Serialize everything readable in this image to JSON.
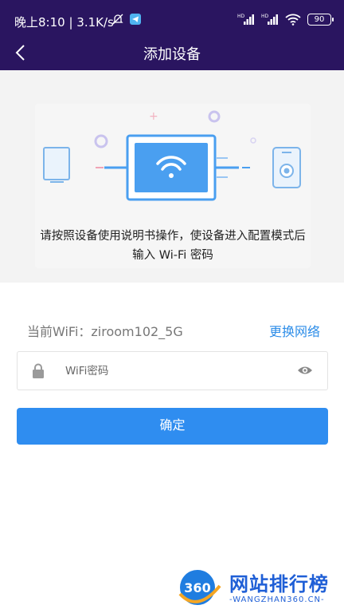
{
  "status_bar": {
    "time": "晚上8:10 | 3.1K/s",
    "battery": "90",
    "signal_labels": [
      "HD",
      "HD"
    ]
  },
  "header": {
    "title": "添加设备"
  },
  "hero": {
    "instruction": "请按照设备使用说明书操作，使设备进入配置模式后输入 Wi-Fi 密码"
  },
  "wifi": {
    "current_label": "当前WiFi：ziroom102_5G",
    "change_network": "更换网络"
  },
  "password": {
    "placeholder": "WiFi密码",
    "value": ""
  },
  "confirm": {
    "label": "确定"
  },
  "watermark": {
    "title": "网站排行榜",
    "subtitle": "-WANGZHAN360.CN-",
    "logo_text": "360"
  },
  "colors": {
    "header_bg": "#2a1560",
    "accent": "#2f8df0",
    "link": "#2d8de8"
  },
  "icons": [
    "back-arrow-icon",
    "lock-icon",
    "eye-icon",
    "wifi-icon",
    "router-icon",
    "phone-icon"
  ]
}
